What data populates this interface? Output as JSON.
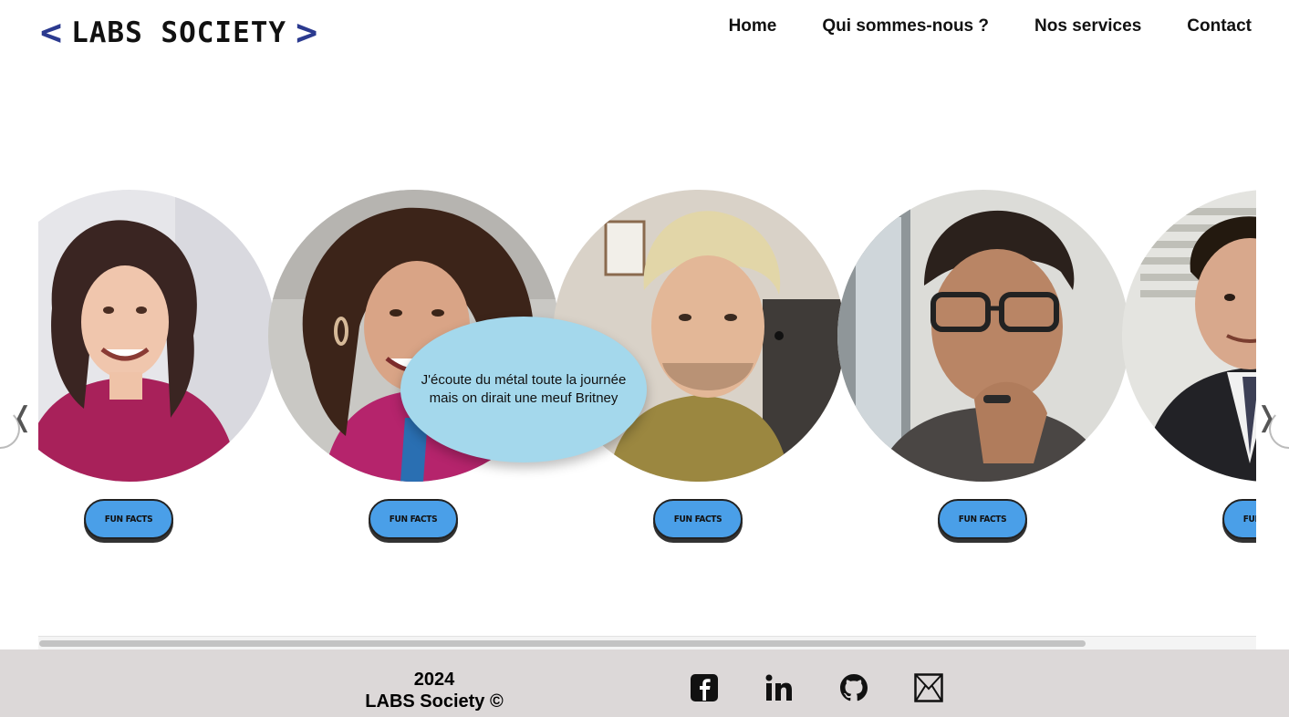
{
  "header": {
    "logo_left": "<",
    "logo_text": "LABS SOCIETY",
    "logo_right": ">",
    "nav": [
      "Home",
      "Qui sommes-nous ?",
      "Nos services",
      "Contact"
    ]
  },
  "team": {
    "members": [
      {
        "button_label": "FUN FACTS"
      },
      {
        "button_label": "FUN FACTS"
      },
      {
        "button_label": "FUN FACTS"
      },
      {
        "button_label": "FUN FACTS"
      },
      {
        "button_label": "FUN FACTS"
      }
    ],
    "fun_fact_bubble": "J'écoute du métal toute la journée mais on dirait une meuf Britney",
    "prev_arrow": "❬",
    "next_arrow": "❭"
  },
  "scroll": {
    "position": 0.86
  },
  "footer": {
    "year": "2024",
    "copyright": "LABS Society ©",
    "socials": [
      "facebook-icon",
      "linkedin-icon",
      "github-icon",
      "mail-icon"
    ]
  },
  "colors": {
    "accent": "#2b3a8f",
    "button": "#4a9fe8",
    "bubble": "#a4d8ec",
    "footer_bg": "#dcd8d8"
  }
}
